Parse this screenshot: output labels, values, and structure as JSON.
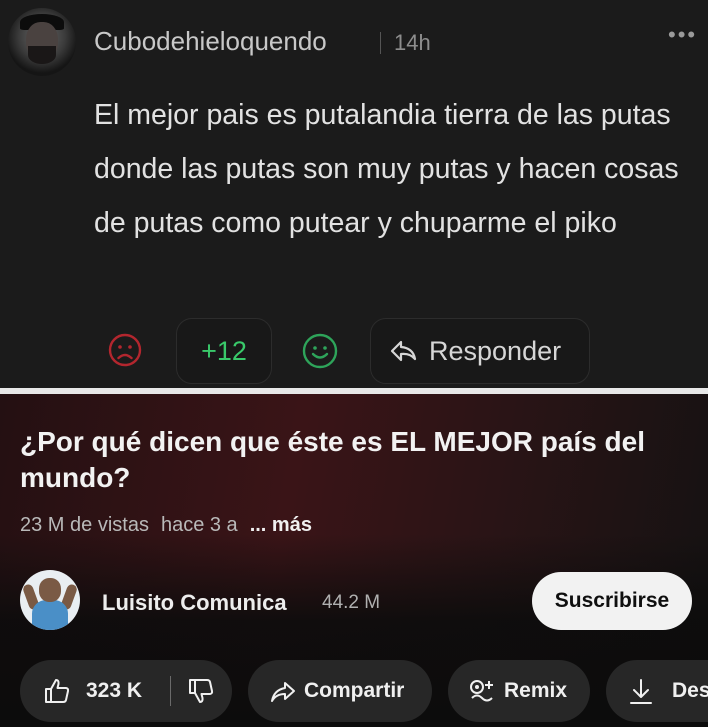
{
  "comment": {
    "username": "Cubodehieloquendo",
    "time": "14h",
    "more_icon": "more-dots-icon",
    "text": "El mejor pais es putalandia tierra de las putas donde las putas son muy putas y hacen cosas de putas como putear y chuparme el piko",
    "votes": "+12",
    "reply_label": "Responder",
    "colors": {
      "votes": "#39c96a",
      "dislike": "#b3262e",
      "like": "#2ea45a"
    }
  },
  "video": {
    "title": "¿Por qué dicen que éste es EL MEJOR país del mundo?",
    "views": "23 M de vistas",
    "ago": "hace 3 a",
    "more": "... más",
    "channel": "Luisito Comunica",
    "subscribers": "44.2 M",
    "subscribe_label": "Suscribirse",
    "actions": {
      "likes": "323 K",
      "share": "Compartir",
      "remix": "Remix",
      "download": "Des"
    }
  }
}
